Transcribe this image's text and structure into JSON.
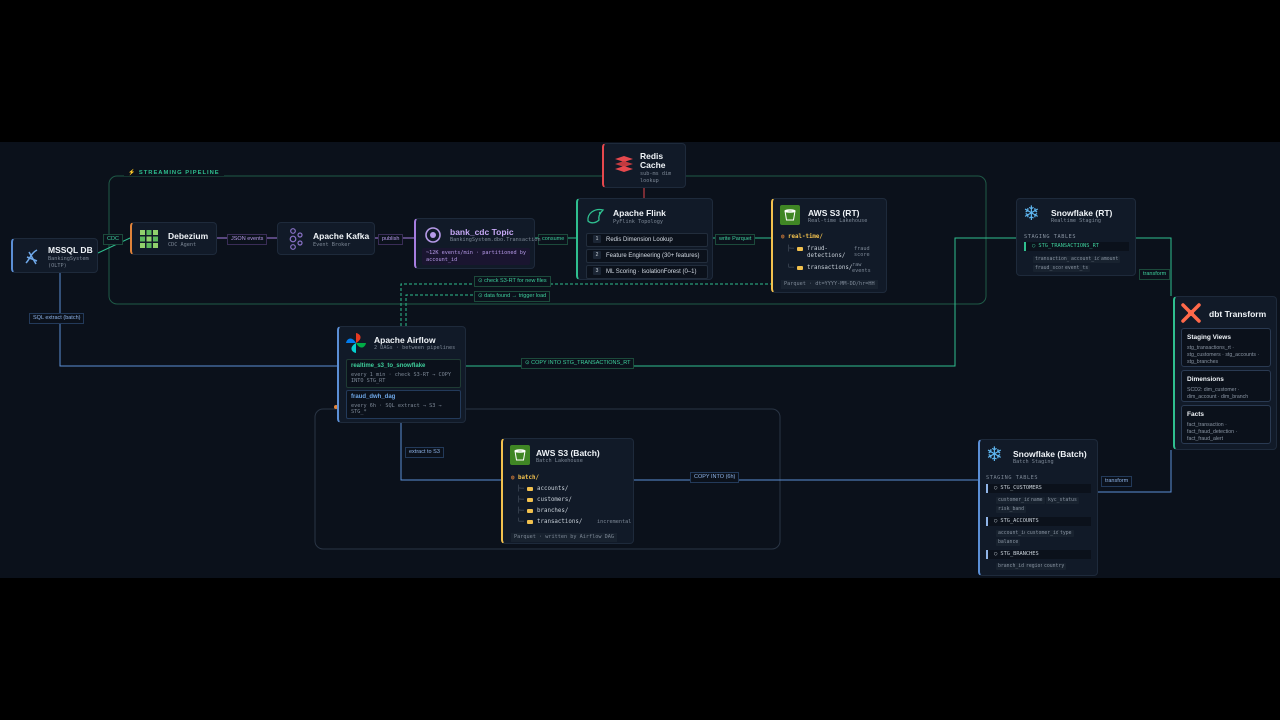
{
  "colors": {
    "background": "#0b111b",
    "streaming_green": "#2fbf8f",
    "purple": "#a67de0",
    "batch_blue": "#5b8fd6",
    "orange": "#e0833a",
    "yellow": "#f2c14e",
    "red": "#e5484d"
  },
  "pipeline": {
    "streaming_label": "STREAMING PIPELINE"
  },
  "nodes": {
    "mssql": {
      "title": "MSSQL DB",
      "sub1": "BankingSystem",
      "sub2": "(OLTP)",
      "icon": "sql-server-icon"
    },
    "debezium": {
      "title": "Debezium",
      "sub": "CDC Agent",
      "icon": "debezium-icon"
    },
    "kafka": {
      "title": "Apache Kafka",
      "sub": "Event Broker",
      "icon": "kafka-icon"
    },
    "topic": {
      "title": "bank_cdc Topic",
      "sub": "BankingSystem.dbo.Transaction",
      "detail1": "~12K events/min · partitioned by",
      "detail2": "account_id",
      "icon": "kafka-topic-icon"
    },
    "redis": {
      "title1": "Redis",
      "title2": "Cache",
      "sub1": "sub-ms dim",
      "sub2": "lookup",
      "icon": "redis-icon"
    },
    "flink": {
      "title": "Apache Flink",
      "sub": "PyFlink Topology",
      "icon": "flink-icon",
      "steps": [
        {
          "num": "1",
          "label": "Redis Dimension Lookup"
        },
        {
          "num": "2",
          "label": "Feature Engineering (30+ features)"
        },
        {
          "num": "3",
          "label": "ML Scoring · IsolationForest (0–1)"
        }
      ]
    },
    "s3_rt": {
      "title": "AWS S3 (RT)",
      "sub": "Real-time Lakehouse",
      "icon": "s3-bucket-icon",
      "root": "real-time/",
      "folder1a": "fraud-",
      "folder1b": "detections/",
      "note1a": "fraud",
      "note1b": "score",
      "folder2": "transactions/",
      "note2a": "raw",
      "note2b": "events",
      "footer": "Parquet · dt=YYYY-MM-DD/hr=HH"
    },
    "snow_rt": {
      "title": "Snowflake (RT)",
      "sub": "Realtime Staging",
      "icon": "snowflake-icon",
      "section": "STAGING TABLES",
      "table": "STG_TRANSACTIONS_RT",
      "cols": [
        "transaction_id",
        "account_id",
        "amount",
        "fraud_score",
        "event_ts"
      ]
    },
    "dbt": {
      "title": "dbt Transform",
      "icon": "dbt-icon",
      "sections": [
        {
          "title": "Staging Views",
          "text": "stg_transactions_rt · stg_customers · stg_accounts · stg_branches"
        },
        {
          "title": "Dimensions",
          "text": "SCD2: dim_customer · dim_account · dim_branch"
        },
        {
          "title": "Facts",
          "text": "fact_transaction · fact_fraud_detection · fact_fraud_alert"
        }
      ]
    },
    "airflow": {
      "title": "Apache Airflow",
      "sub": "2 DAGs · between pipelines",
      "icon": "airflow-icon",
      "dag1_name": "realtime_s3_to_snowflake",
      "dag1_desc1": "every 1 min · check S3-RT → COPY",
      "dag1_desc2": "INTO STG_RT",
      "dag2_name": "fraud_dwh_dag",
      "dag2_desc1": "every 6h · SQL extract → S3 →",
      "dag2_desc2": "STG_*"
    },
    "s3_batch": {
      "title": "AWS S3 (Batch)",
      "sub": "Batch Lakehouse",
      "icon": "s3-bucket-icon",
      "root": "batch/",
      "folders": [
        "accounts/",
        "customers/",
        "branches/",
        "transactions/"
      ],
      "note": "incremental",
      "footer": "Parquet · written by Airflow DAG"
    },
    "snow_batch": {
      "title": "Snowflake (Batch)",
      "sub": "Batch Staging",
      "icon": "snowflake-icon",
      "section": "STAGING TABLES",
      "tables": [
        {
          "name": "STG_CUSTOMERS",
          "cols": [
            "customer_id",
            "name",
            "kyc_status",
            "risk_band"
          ]
        },
        {
          "name": "STG_ACCOUNTS",
          "cols": [
            "account_id",
            "customer_id",
            "type",
            "balance"
          ]
        },
        {
          "name": "STG_BRANCHES",
          "cols": [
            "branch_id",
            "region",
            "country"
          ]
        }
      ]
    }
  },
  "edges": {
    "cdc": "CDC",
    "json_events": "JSON events",
    "publish": "publish",
    "consume": "consume",
    "write_parquet": "write Parquet",
    "check_s3": "⊙ check S3-RT for new files",
    "data_found": "⊙ data found → trigger load",
    "copy_rt": "⊙ COPY INTO STG_TRANSACTIONS_RT",
    "sql_extract": "SQL extract (batch)",
    "extract_s3": "extract to S3",
    "copy_6h": "COPY INTO (6h)",
    "transform_rt": "transform",
    "transform_batch": "transform"
  }
}
